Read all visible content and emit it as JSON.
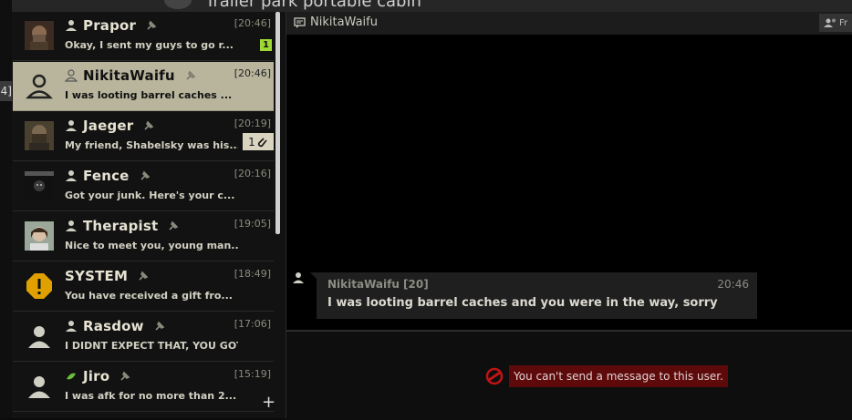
{
  "background": {
    "title": "Trailer park portable cabin",
    "edge_label": "4]"
  },
  "dialogs": [
    {
      "name": "Prapor",
      "time": "[20:46]",
      "preview": "Okay, I sent my guys to go r...",
      "badge": "1",
      "avatar": "prapor-portrait",
      "selected": false
    },
    {
      "name": "NikitaWaifu",
      "time": "[20:46]",
      "preview": "I was looting barrel caches ...",
      "avatar": "default-user",
      "selected": true
    },
    {
      "name": "Jaeger",
      "time": "[20:19]",
      "preview": "My friend, Shabelsky was his...",
      "attachment_count": "1",
      "avatar": "jaeger-portrait",
      "selected": false
    },
    {
      "name": "Fence",
      "time": "[20:16]",
      "preview": "Got your junk. Here's your c...",
      "avatar": "fence-portrait",
      "selected": false
    },
    {
      "name": "Therapist",
      "time": "[19:05]",
      "preview": "Nice to meet you, young man....",
      "avatar": "therapist-portrait",
      "selected": false
    },
    {
      "name": "SYSTEM",
      "time": "[18:49]",
      "preview": "You have received a gift fro...",
      "avatar": "warning-icon",
      "selected": false
    },
    {
      "name": "Rasdow",
      "time": "[17:06]",
      "preview": "I DIDNT EXPECT THAT, YOU GOT...",
      "avatar": "default-user",
      "selected": false
    },
    {
      "name": "Jiro",
      "time": "[15:19]",
      "preview": "I was afk for no more than 2...",
      "avatar": "default-user",
      "selected": false
    }
  ],
  "add_button": "+",
  "chat": {
    "title": "NikitaWaifu",
    "friend_button": "Fr",
    "message": {
      "author": "NikitaWaifu [20]",
      "time": "20:46",
      "text": "I was looting barrel caches and you were in the way, sorry"
    },
    "blocked_notice": "You can't send a message to this user."
  },
  "colors": {
    "selected_row": "#b8b59c",
    "unread_badge": "#9ed936",
    "blocked_bg": "#5e0a0a",
    "system_warning": "#e0a100"
  }
}
